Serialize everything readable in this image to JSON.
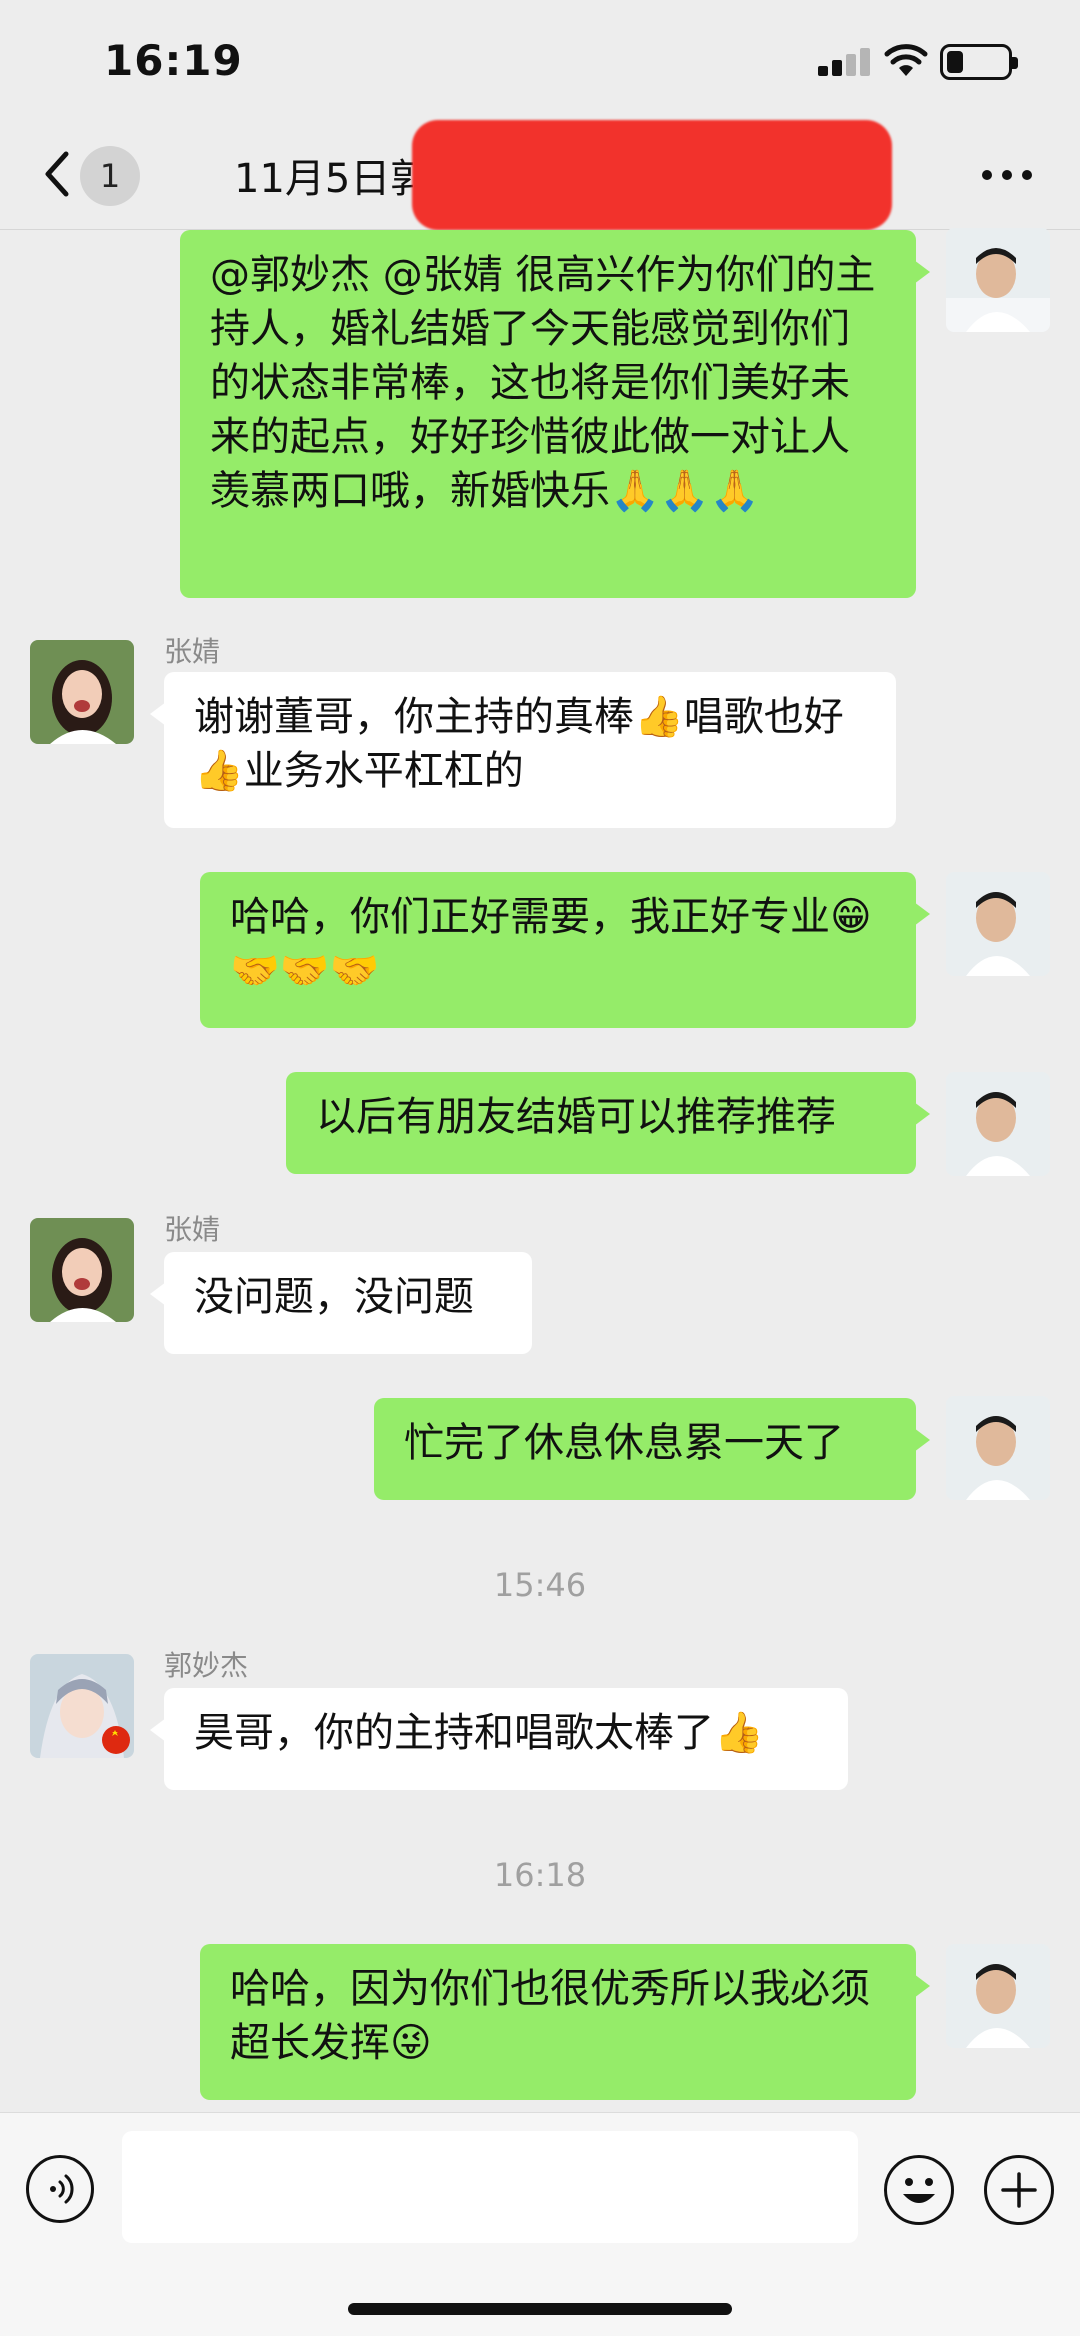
{
  "status_bar": {
    "time": "16:19"
  },
  "nav": {
    "back_badge": "1",
    "title": "11月5日郭"
  },
  "messages": [
    {
      "text": "@郭妙杰 @张婧 很高兴作为你们的主持人，婚礼结婚了今天能感觉到你们的状态非常棒，这也将是你们美好未来的起点，好好珍惜彼此做一对让人羡慕两口哦，新婚快乐🙏🙏🙏"
    },
    {
      "sender": "张婧",
      "text": "谢谢董哥，你主持的真棒👍唱歌也好👍业务水平杠杠的"
    },
    {
      "text": "哈哈，你们正好需要，我正好专业😁🤝🤝🤝"
    },
    {
      "text": "以后有朋友结婚可以推荐推荐"
    },
    {
      "sender": "张婧",
      "text": "没问题，没问题"
    },
    {
      "text": "忙完了休息休息累一天了"
    },
    {
      "timestamp": "15:46"
    },
    {
      "sender": "郭妙杰",
      "text": "昊哥，你的主持和唱歌太棒了👍"
    },
    {
      "timestamp": "16:18"
    },
    {
      "text": "哈哈，因为你们也很优秀所以我必须超长发挥😜"
    }
  ],
  "icons": {
    "back": "chevron-left-icon",
    "more": "more-dots-icon",
    "voice": "voice-icon",
    "emoji": "emoji-icon",
    "plus": "plus-icon"
  },
  "colors": {
    "my_bubble": "#95ec69",
    "other_bubble": "#ffffff",
    "background": "#ededed"
  }
}
